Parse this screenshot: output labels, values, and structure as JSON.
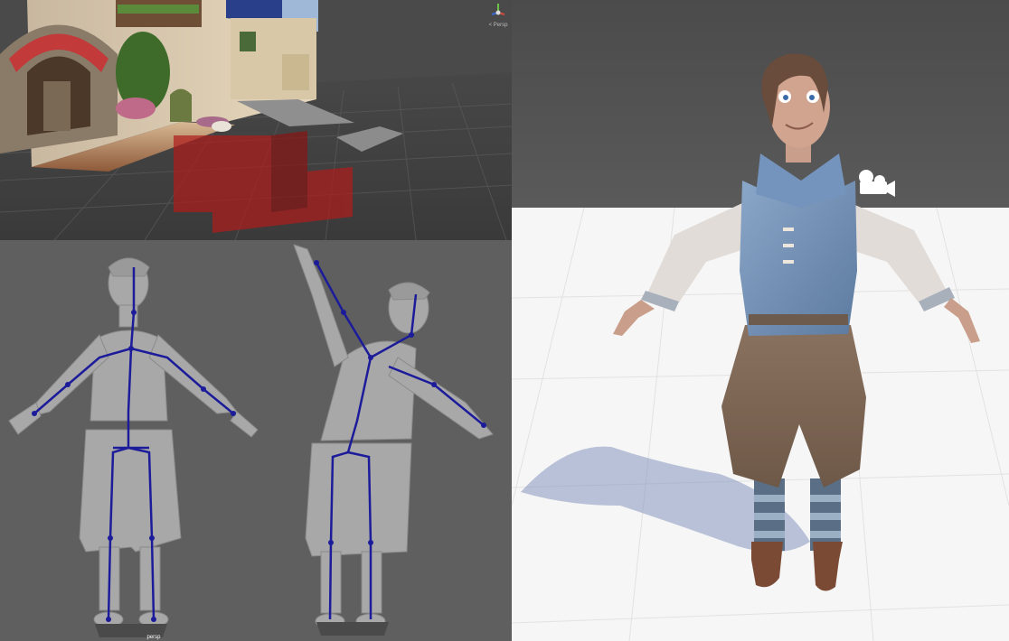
{
  "scene_view": {
    "gizmo_label": "< Persp"
  },
  "rig_view": {
    "camera_label": "persp"
  }
}
